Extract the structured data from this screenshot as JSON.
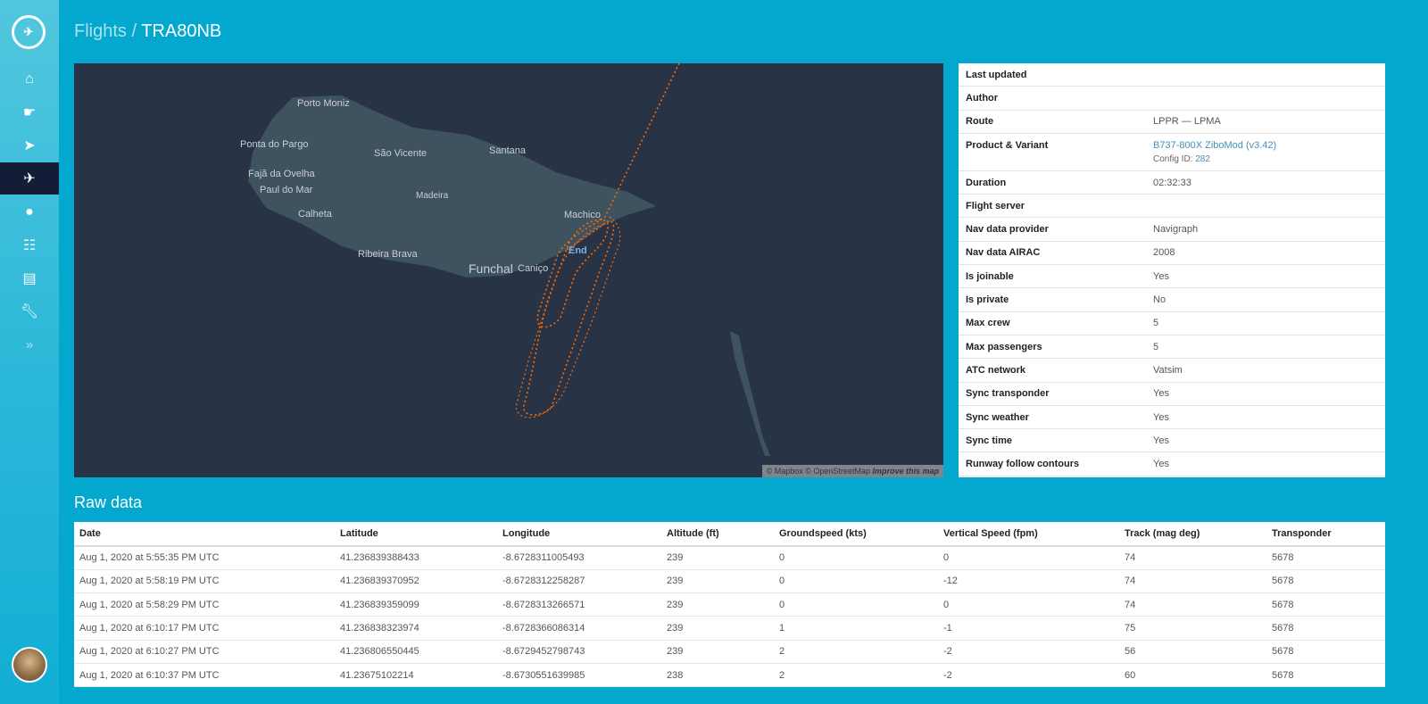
{
  "breadcrumb": {
    "section": "Flights",
    "separator": "/",
    "current": "TRA80NB"
  },
  "sidebar": {
    "logo": "logo",
    "items": [
      {
        "icon": "home-icon"
      },
      {
        "icon": "hand-pointer-icon"
      },
      {
        "icon": "paper-plane-icon"
      },
      {
        "icon": "plane-departure-icon",
        "active": true
      },
      {
        "icon": "globe-icon"
      },
      {
        "icon": "sitemap-icon"
      },
      {
        "icon": "id-card-icon"
      },
      {
        "icon": "wrench-icon"
      },
      {
        "icon": "chevron-double-right-icon"
      }
    ]
  },
  "map": {
    "labels": [
      "Porto Moniz",
      "Ponta do Pargo",
      "São Vicente",
      "Santana",
      "Fajã da Ovelha",
      "Paul do Mar",
      "Madeira",
      "Calheta",
      "Machico",
      "Ribeira Brava",
      "Funchal",
      "Caniço"
    ],
    "end_label": "End",
    "attribution": {
      "mapbox": "© Mapbox",
      "osm": "© OpenStreetMap",
      "improve": "Improve this map"
    },
    "track_color": "#ff6a00"
  },
  "info": [
    {
      "k": "Last updated",
      "v": ""
    },
    {
      "k": "Author",
      "v": ""
    },
    {
      "k": "Route",
      "v": "LPPR — LPMA"
    },
    {
      "k": "Product & Variant",
      "v": "B737-800X ZiboMod (v3.42)",
      "sub_label": "Config ID:",
      "sub_value": "282"
    },
    {
      "k": "Duration",
      "v": "02:32:33"
    },
    {
      "k": "Flight server",
      "v": ""
    },
    {
      "k": "Nav data provider",
      "v": "Navigraph"
    },
    {
      "k": "Nav data AIRAC",
      "v": "2008"
    },
    {
      "k": "Is joinable",
      "v": "Yes"
    },
    {
      "k": "Is private",
      "v": "No"
    },
    {
      "k": "Max crew",
      "v": "5"
    },
    {
      "k": "Max passengers",
      "v": "5"
    },
    {
      "k": "ATC network",
      "v": "Vatsim"
    },
    {
      "k": "Sync transponder",
      "v": "Yes"
    },
    {
      "k": "Sync weather",
      "v": "Yes"
    },
    {
      "k": "Sync time",
      "v": "Yes"
    },
    {
      "k": "Runway follow contours",
      "v": "Yes"
    }
  ],
  "raw": {
    "title": "Raw data",
    "columns": [
      "Date",
      "Latitude",
      "Longitude",
      "Altitude (ft)",
      "Groundspeed (kts)",
      "Vertical Speed (fpm)",
      "Track (mag deg)",
      "Transponder"
    ],
    "rows": [
      [
        "Aug 1, 2020 at 5:55:35 PM UTC",
        "41.236839388433",
        "-8.6728311005493",
        "239",
        "0",
        "0",
        "74",
        "5678"
      ],
      [
        "Aug 1, 2020 at 5:58:19 PM UTC",
        "41.236839370952",
        "-8.6728312258287",
        "239",
        "0",
        "-12",
        "74",
        "5678"
      ],
      [
        "Aug 1, 2020 at 5:58:29 PM UTC",
        "41.236839359099",
        "-8.6728313266571",
        "239",
        "0",
        "0",
        "74",
        "5678"
      ],
      [
        "Aug 1, 2020 at 6:10:17 PM UTC",
        "41.236838323974",
        "-8.6728366086314",
        "239",
        "1",
        "-1",
        "75",
        "5678"
      ],
      [
        "Aug 1, 2020 at 6:10:27 PM UTC",
        "41.236806550445",
        "-8.6729452798743",
        "239",
        "2",
        "-2",
        "56",
        "5678"
      ],
      [
        "Aug 1, 2020 at 6:10:37 PM UTC",
        "41.23675102214",
        "-8.6730551639985",
        "238",
        "2",
        "-2",
        "60",
        "5678"
      ]
    ]
  }
}
